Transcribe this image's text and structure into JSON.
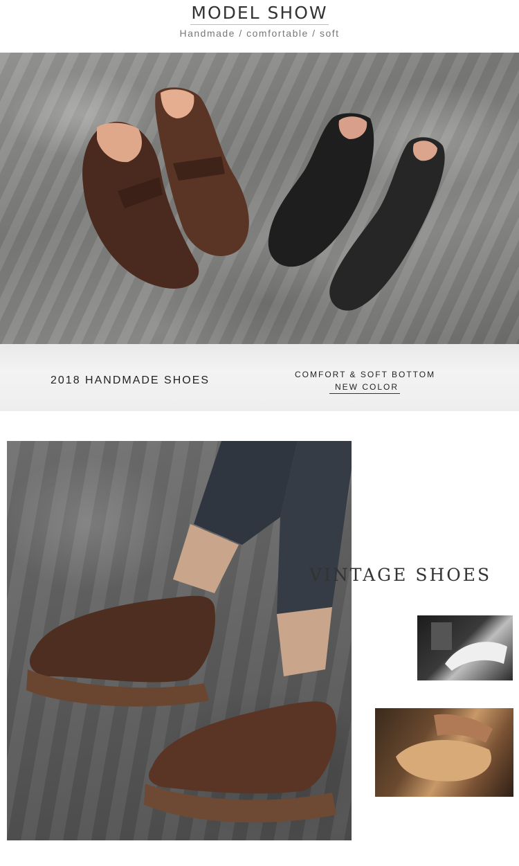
{
  "header": {
    "title": "MODEL SHOW",
    "subtitle": "Handmade / comfortable / soft"
  },
  "banner": {
    "left_text": "2018 HANDMADE SHOES",
    "right_top": "COMFORT & SOFT BOTTOM",
    "right_bottom": "NEW COLOR"
  },
  "section": {
    "heading": "VINTAGE SHOES"
  },
  "colors": {
    "text_dark": "#333333",
    "text_muted": "#777777",
    "brown_leather": "#5a3424",
    "black_leather": "#1e1e1e",
    "backdrop_grey": "#8a8a88"
  },
  "images": {
    "hero": "brown-and-black-shoes-on-grey-cloth",
    "model": "model-wearing-brown-shoes",
    "detail1": "sewing-machine-detail",
    "detail2": "hands-crafting-leather"
  }
}
